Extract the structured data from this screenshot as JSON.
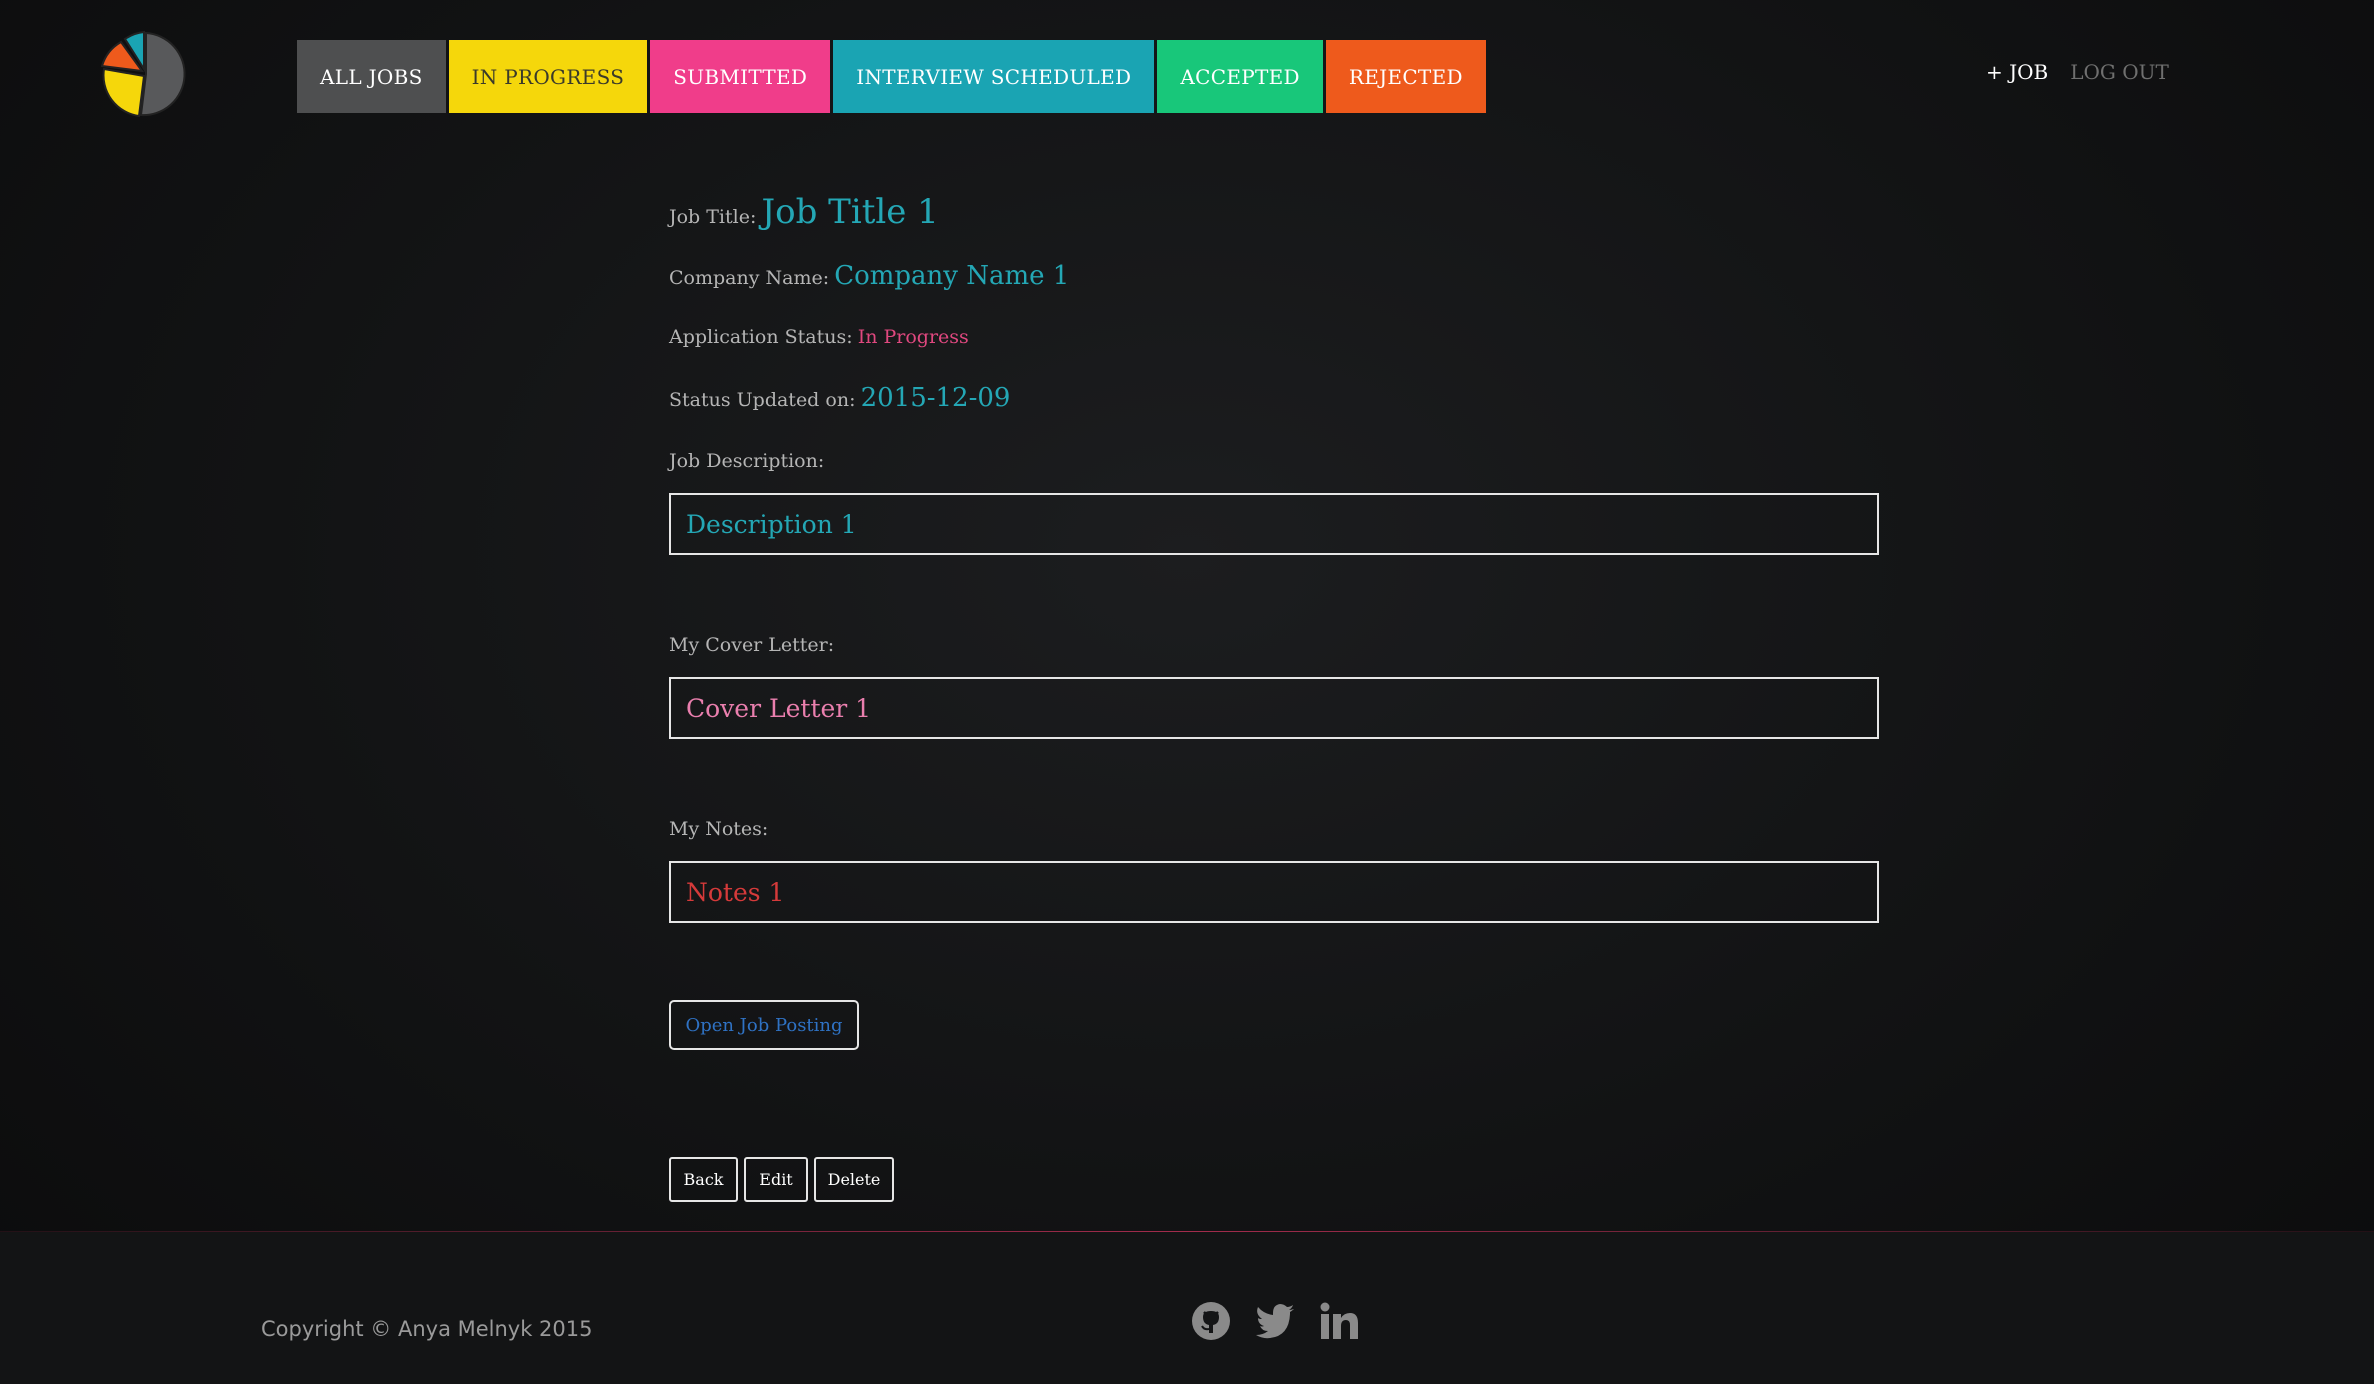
{
  "nav": {
    "tabs": [
      "ALL JOBS",
      "IN PROGRESS",
      "SUBMITTED",
      "INTERVIEW SCHEDULED",
      "ACCEPTED",
      "REJECTED"
    ],
    "add_job": "+ JOB",
    "logout": "LOG OUT"
  },
  "job": {
    "title_label": "Job Title:",
    "title": "Job Title 1",
    "company_label": "Company Name:",
    "company": "Company Name 1",
    "status_label": "Application Status:",
    "status": "In Progress",
    "updated_label": "Status Updated on:",
    "updated": "2015-12-09",
    "description_label": "Job Description:",
    "description": "Description 1",
    "cover_label": "My Cover Letter:",
    "cover": "Cover Letter 1",
    "notes_label": "My Notes:",
    "notes": "Notes 1"
  },
  "buttons": {
    "open_posting": "Open Job Posting",
    "back": "Back",
    "edit": "Edit",
    "delete": "Delete"
  },
  "footer": {
    "copyright": "Copyright © Anya Melnyk 2015",
    "icons": [
      "github-icon",
      "twitter-icon",
      "linkedin-icon"
    ]
  },
  "colors": {
    "accent_teal": "#24a7b5",
    "status_pink": "#e0487f",
    "tab_progress": "#f5d70b",
    "tab_submitted": "#f03d8a",
    "tab_interview": "#1aa4b3",
    "tab_accepted": "#18c77a",
    "tab_rejected": "#ee5a1c"
  }
}
